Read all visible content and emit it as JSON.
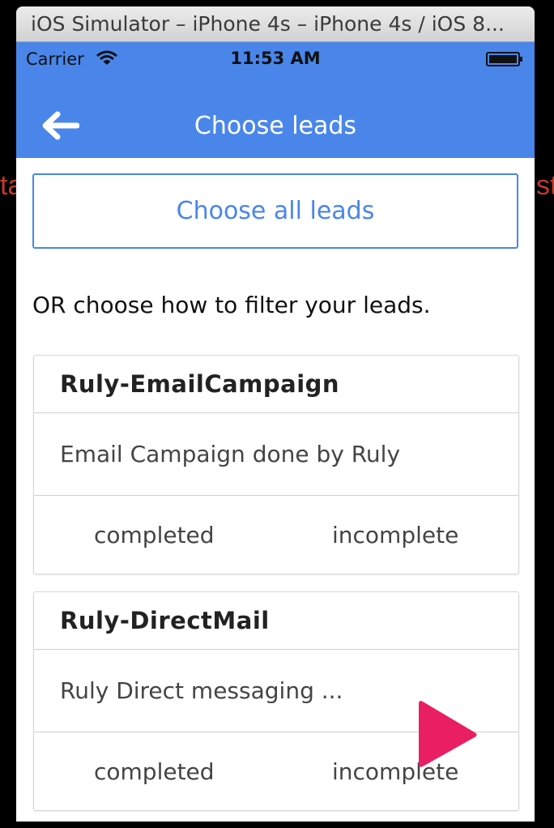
{
  "window": {
    "title": "iOS Simulator – iPhone 4s – iPhone 4s / iOS 8..."
  },
  "status_bar": {
    "carrier": "Carrier",
    "time": "11:53 AM"
  },
  "nav": {
    "title": "Choose leads",
    "back_icon": "arrow-left-icon"
  },
  "background_bleed": {
    "left": "ta",
    "right": "st"
  },
  "choose_all_label": "Choose all leads",
  "instruction": "OR choose how to filter your leads.",
  "campaigns": [
    {
      "title": "Ruly-EmailCampaign",
      "description": "Email Campaign done by Ruly",
      "completed_label": "completed",
      "incomplete_label": "incomplete"
    },
    {
      "title": "Ruly-DirectMail",
      "description": "Ruly Direct messaging ...",
      "completed_label": "completed",
      "incomplete_label": "incomplete"
    }
  ],
  "colors": {
    "primary": "#4a86ea",
    "accent": "#e91e63"
  }
}
